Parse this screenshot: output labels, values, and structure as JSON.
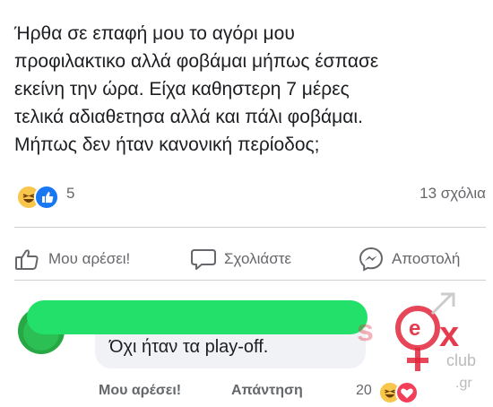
{
  "post": {
    "lines": [
      "Ήρθα σε επαφή μου το αγόρι μου",
      "προφιλακτικο αλλά φοβάμαι μήπως έσπασε",
      "εκείνη την ώρα. Είχα καθηστερη 7 μέρες",
      "τελικά αδιαθετησα αλλά και πάλι φοβάμαι.",
      "Μήπως δεν ήταν κανονική περίοδος;"
    ]
  },
  "reactions": {
    "count": "5",
    "comments": "13 σχόλια",
    "icons": [
      "haha-icon",
      "like-icon"
    ]
  },
  "actions": {
    "like": "Μου αρέσει!",
    "comment": "Σχολιάστε",
    "share": "Αποστολή"
  },
  "comment": {
    "text": "Όχι ήταν τα play-off.",
    "like": "Μου αρέσει!",
    "reply": "Απάντηση",
    "reaction_count": "20"
  },
  "watermark": {
    "text": "sex club .gr"
  },
  "colors": {
    "text": "#1c1e21",
    "muted": "#65676b",
    "divider": "#ced0d4",
    "bubble": "#f0f2f5",
    "facebook_blue": "#1877f2",
    "redaction_green": "#22e06a",
    "watermark_red": "#e3263b"
  }
}
